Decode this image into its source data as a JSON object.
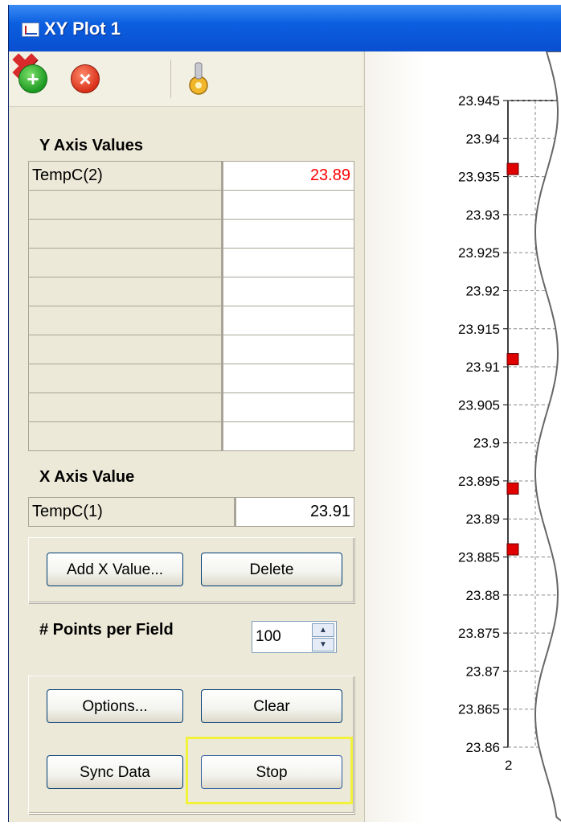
{
  "window": {
    "title": "XY Plot 1"
  },
  "toolbar": {
    "icons": [
      "add-icon",
      "remove-icon",
      "delete-icon",
      "properties-icon"
    ]
  },
  "y_axis": {
    "label": "Y Axis Values",
    "rows": [
      {
        "name": "TempC(2)",
        "value": "23.89"
      },
      {
        "name": "",
        "value": ""
      },
      {
        "name": "",
        "value": ""
      },
      {
        "name": "",
        "value": ""
      },
      {
        "name": "",
        "value": ""
      },
      {
        "name": "",
        "value": ""
      },
      {
        "name": "",
        "value": ""
      },
      {
        "name": "",
        "value": ""
      },
      {
        "name": "",
        "value": ""
      },
      {
        "name": "",
        "value": ""
      }
    ],
    "value_color": "#ff0000"
  },
  "x_axis": {
    "label": "X Axis Value",
    "name": "TempC(1)",
    "value": "23.91"
  },
  "buttons": {
    "add_x": "Add X Value...",
    "delete": "Delete",
    "options": "Options...",
    "clear": "Clear",
    "sync": "Sync Data",
    "stop": "Stop"
  },
  "points": {
    "label": "# Points per Field",
    "value": "100"
  },
  "chart_data": {
    "type": "scatter",
    "y_ticks": [
      "23.945",
      "23.94",
      "23.935",
      "23.93",
      "23.925",
      "23.92",
      "23.915",
      "23.91",
      "23.905",
      "23.9",
      "23.895",
      "23.89",
      "23.885",
      "23.88",
      "23.875",
      "23.87",
      "23.865",
      "23.86"
    ],
    "ylim": [
      23.86,
      23.945
    ],
    "y_points": [
      23.936,
      23.911,
      23.894,
      23.886
    ],
    "x_tick_partial": "2",
    "marker_color": "#e00000",
    "grid": true
  }
}
